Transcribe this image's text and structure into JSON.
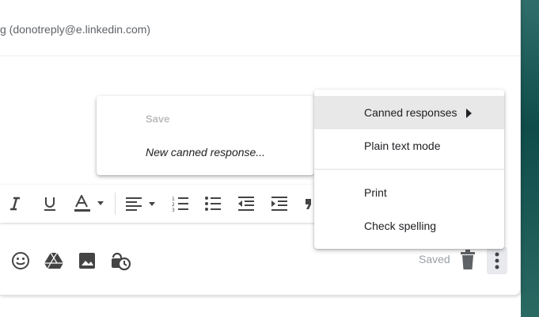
{
  "header": {
    "recipient_text": "g (donotreply@e.linkedin.com)"
  },
  "canned_submenu": {
    "items": [
      {
        "label": "Save",
        "disabled": true
      },
      {
        "label": "New canned response..."
      }
    ]
  },
  "more_menu": {
    "items": [
      {
        "label": "Canned responses",
        "has_submenu": true,
        "highlighted": true
      },
      {
        "label": "Plain text mode"
      },
      {
        "label": "Print"
      },
      {
        "label": "Check spelling"
      }
    ]
  },
  "formatting_toolbar": {
    "icons": [
      "italic-icon",
      "underline-icon",
      "text-color-icon",
      "align-icon",
      "numbered-list-icon",
      "bulleted-list-icon",
      "indent-less-icon",
      "indent-more-icon",
      "quote-icon"
    ]
  },
  "bottom_bar": {
    "icons": [
      "emoji-icon",
      "drive-icon",
      "photo-icon",
      "confidential-mode-icon"
    ],
    "status": "Saved"
  },
  "colors": {
    "menu_highlight": "#e8e8e8",
    "disabled_text": "#bdbdbd",
    "background_sea": "#0f4c4a"
  }
}
